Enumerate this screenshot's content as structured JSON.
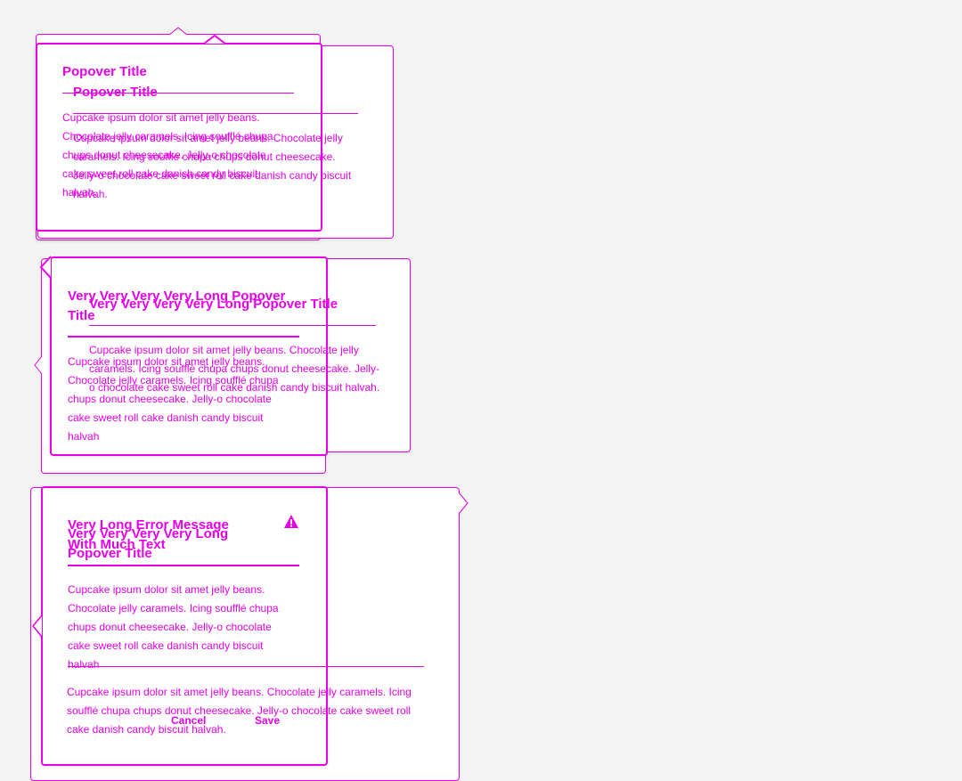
{
  "popover_a": {
    "title": "Popover Title",
    "body": "Cupcake ipsum dolor sit amet jelly beans. Chocolate jelly caramels. Icing soufflé chupa chups donut cheesecake. Jelly-o chocolate cake sweet roll cake danish candy biscuit halvah."
  },
  "popover_a_ghost": {
    "title": "Popover Title",
    "body": "Cupcake ipsum dolor sit amet jelly beans. Chocolate jelly caramels. Icing soufflé chupa chups donut cheesecake. Jelly-o chocolate cake sweet roll cake danish candy biscuit halvah."
  },
  "popover_b": {
    "title": "Very Very Very Very Long Popover Title",
    "body": "Cupcake ipsum dolor sit amet jelly beans. Chocolate jelly caramels. Icing soufflé chupa chups donut cheesecake. Jelly-o chocolate cake sweet roll cake danish candy biscuit halvah"
  },
  "popover_b_ghost": {
    "title": "Very Very Very Very Long Popover Title",
    "body": "Cupcake ipsum dolor sit amet jelly beans. Chocolate jelly caramels. Icing soufflé chupa chups donut cheesecake. Jelly-o chocolate cake sweet roll cake danish candy biscuit halvah."
  },
  "popover_c": {
    "error_title": "Very Long Error Message With Much Text",
    "title": "Very Very Very Very Long Popover Title",
    "body": "Cupcake ipsum dolor sit amet jelly beans. Chocolate jelly caramels. Icing soufflé chupa chups donut cheesecake. Jelly-o chocolate cake sweet roll cake danish candy biscuit halvah",
    "dialog_body": "Cupcake ipsum dolor sit amet jelly beans. Chocolate jelly caramels. Icing soufflé chupa chups donut cheesecake. Jelly-o chocolate cake sweet roll cake danish candy biscuit halvah.",
    "cancel_label": "Cancel",
    "save_label": "Save",
    "warning_icon": "alert-triangle"
  },
  "colors": {
    "accent": "#e600e6",
    "background": "#f4f4f4",
    "surface": "#ffffff"
  }
}
